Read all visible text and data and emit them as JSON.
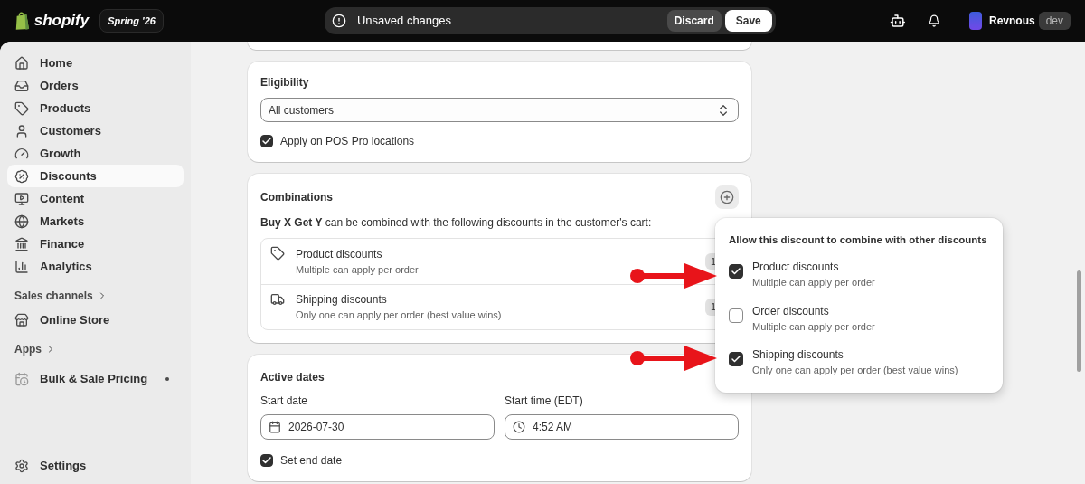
{
  "topbar": {
    "brand": "shopify",
    "edition": "Spring '26",
    "notice": "Unsaved changes",
    "discard": "Discard",
    "save": "Save",
    "store": "Revnous",
    "store_tag": "dev"
  },
  "sidebar": {
    "items": [
      {
        "kind": "item",
        "label": "Home",
        "selected": false
      },
      {
        "kind": "item",
        "label": "Orders",
        "selected": false
      },
      {
        "kind": "item",
        "label": "Products",
        "selected": false
      },
      {
        "kind": "item",
        "label": "Customers",
        "selected": false
      },
      {
        "kind": "item",
        "label": "Growth",
        "selected": false
      },
      {
        "kind": "item",
        "label": "Discounts",
        "selected": true
      },
      {
        "kind": "item",
        "label": "Content",
        "selected": false
      },
      {
        "kind": "item",
        "label": "Markets",
        "selected": false
      },
      {
        "kind": "item",
        "label": "Finance",
        "selected": false
      },
      {
        "kind": "item",
        "label": "Analytics",
        "selected": false
      },
      {
        "kind": "heading",
        "label": "Sales channels"
      },
      {
        "kind": "item",
        "label": "Online Store",
        "selected": false
      },
      {
        "kind": "heading",
        "label": "Apps"
      },
      {
        "kind": "app",
        "label": "Bulk & Sale Pricing",
        "selected": false
      }
    ],
    "settings": "Settings"
  },
  "eligibility": {
    "title": "Eligibility",
    "select": "All customers",
    "checkbox": {
      "label": "Apply on POS Pro locations",
      "checked": true
    }
  },
  "combinations": {
    "title": "Combinations",
    "description": "**Buy X Get Y** can be combined with the following discounts in the customer's cart:",
    "items": [
      {
        "title": "Product discounts",
        "subtitle": "Multiple can apply per order",
        "count": "1"
      },
      {
        "title": "Shipping discounts",
        "subtitle": "Only one can apply per order (best value wins)",
        "count": "1"
      }
    ]
  },
  "popover": {
    "title": "Allow this discount to combine with other discounts",
    "options": [
      {
        "title": "Product discounts",
        "subtitle": "Multiple can apply per order",
        "checked": true
      },
      {
        "title": "Order discounts",
        "subtitle": "Multiple can apply per order",
        "checked": false
      },
      {
        "title": "Shipping discounts",
        "subtitle": "Only one can apply per order (best value wins)",
        "checked": true
      }
    ]
  },
  "active_dates": {
    "title": "Active dates",
    "start_date_label": "Start date",
    "start_date": "2026-07-30",
    "start_time_label": "Start time (EDT)",
    "start_time": "4:52 AM",
    "end_date": {
      "label": "Set end date",
      "checked": true
    }
  }
}
